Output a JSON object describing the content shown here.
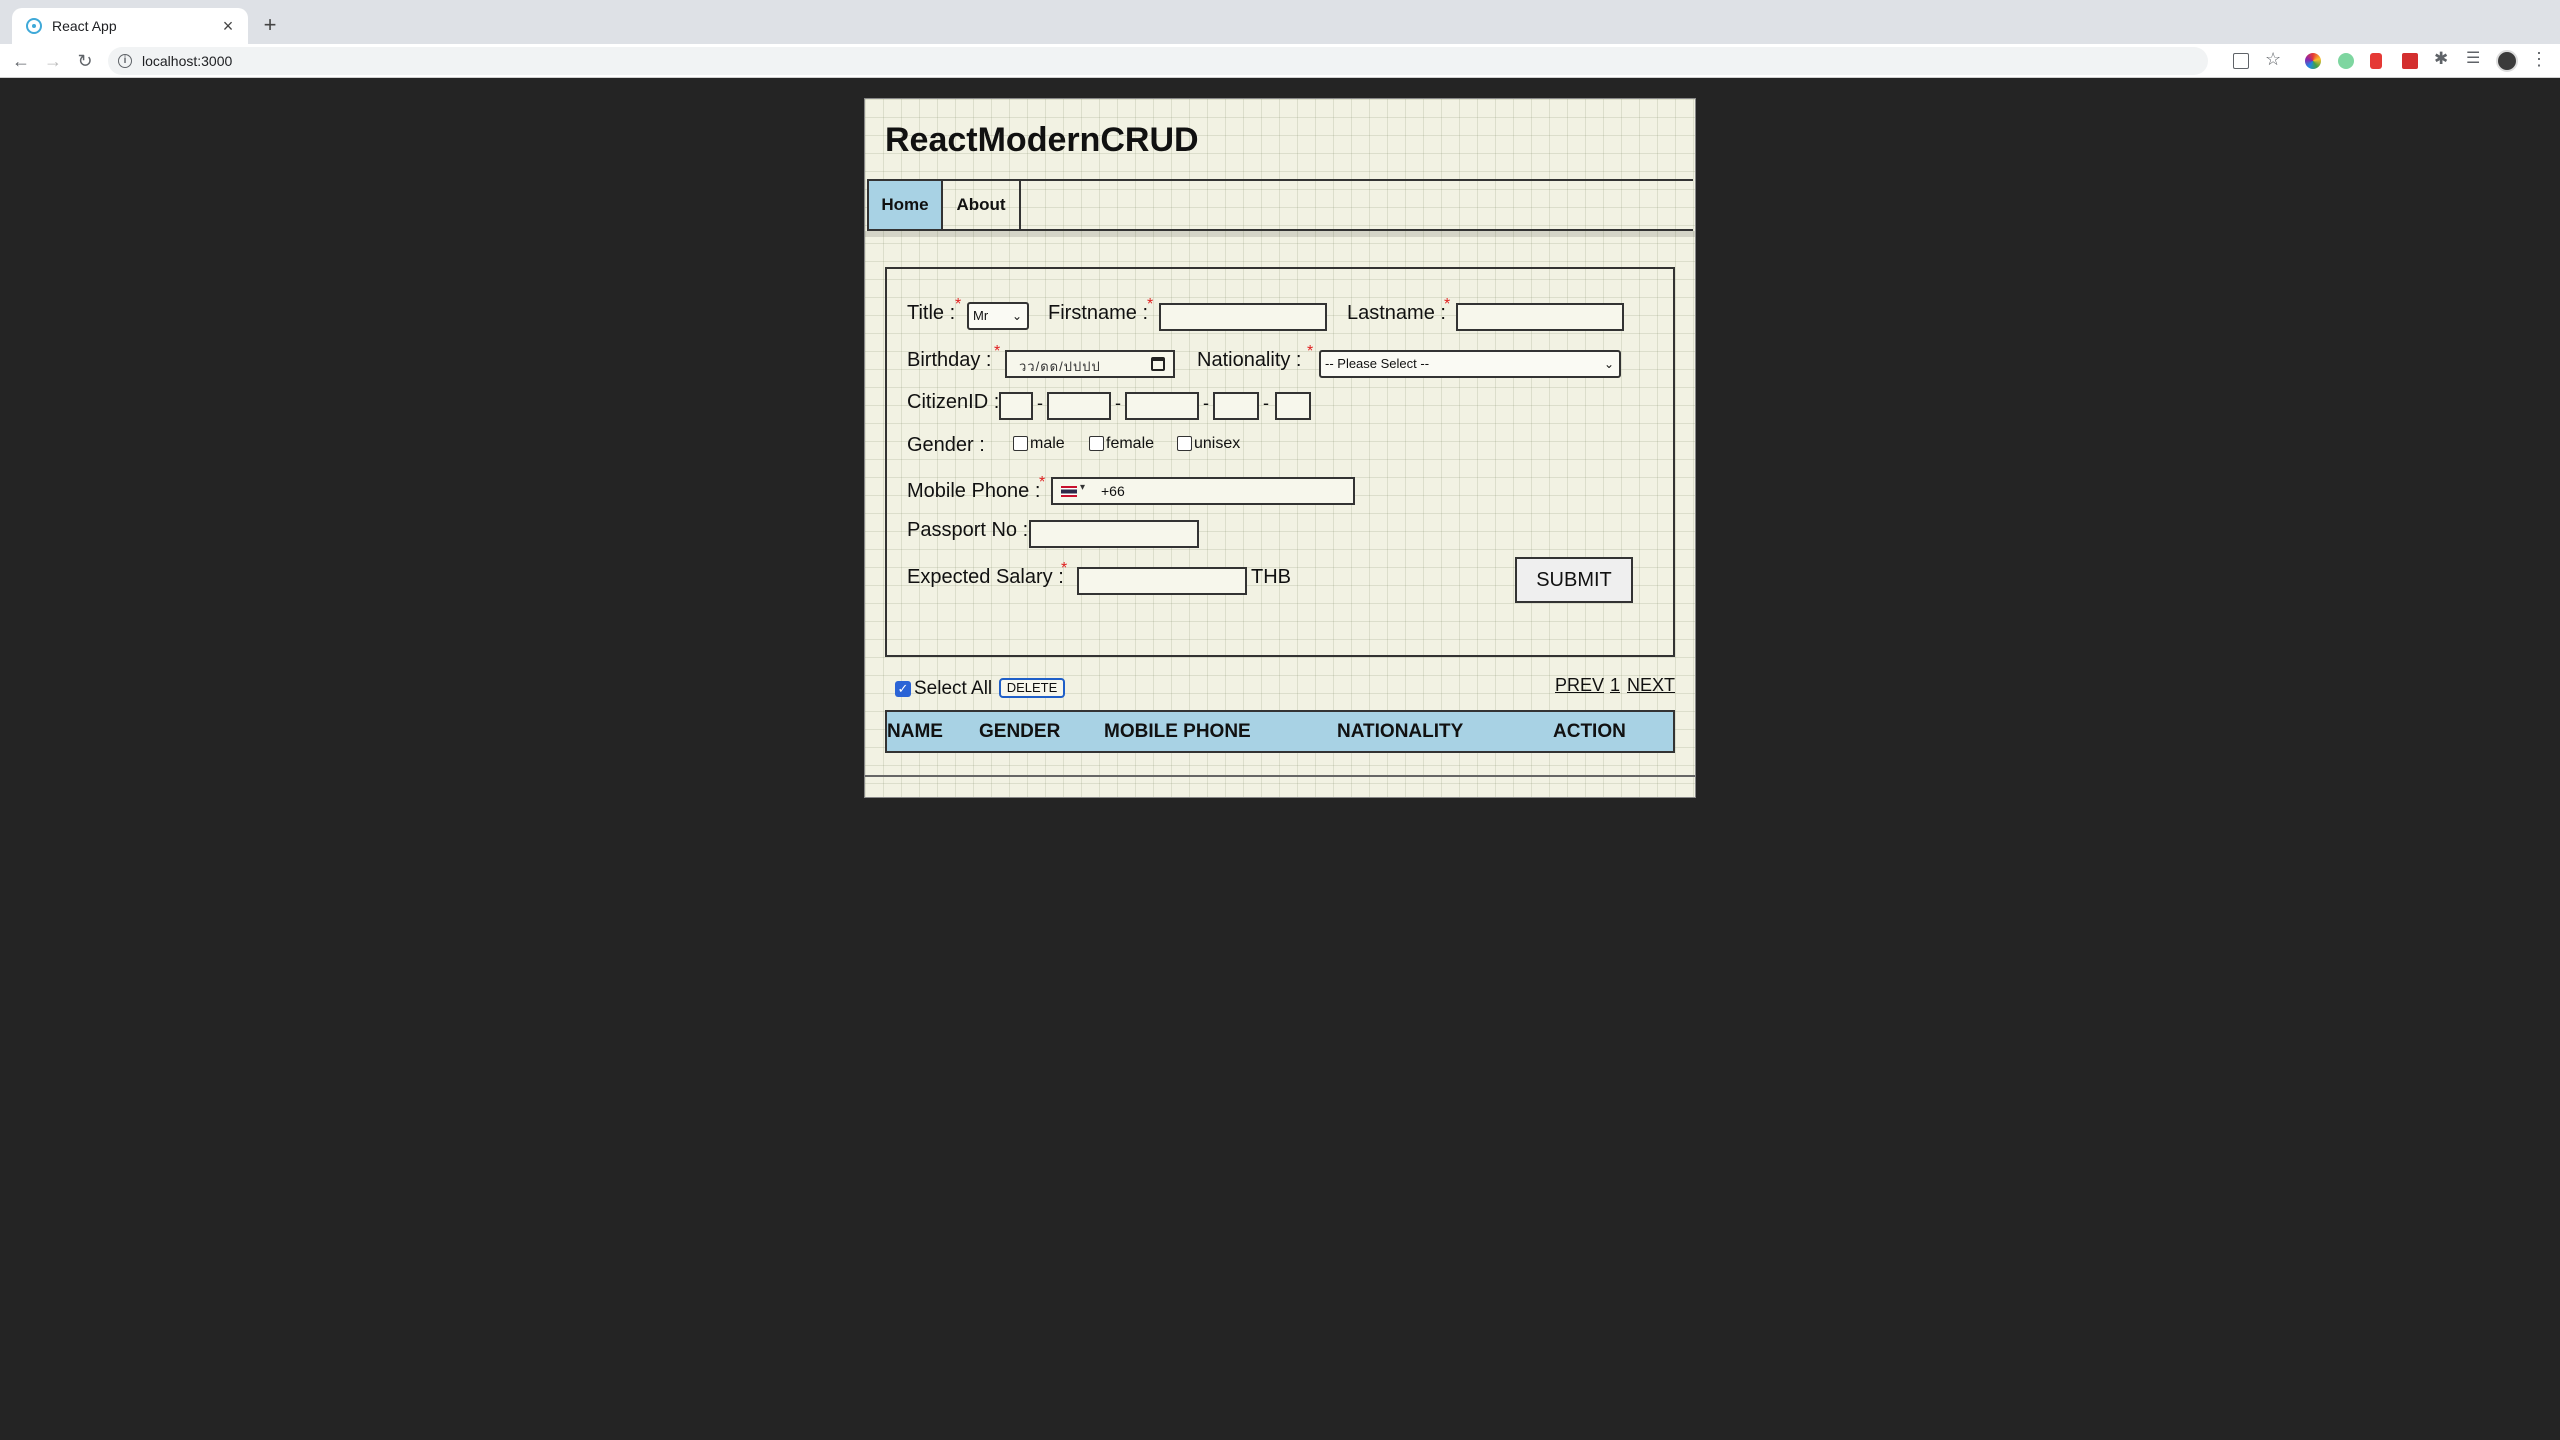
{
  "browser": {
    "tab_title": "React App",
    "tab_close": "×",
    "new_tab": "+",
    "back": "←",
    "forward": "→",
    "reload": "↻",
    "url": "localhost:3000"
  },
  "app": {
    "brand": "ReactModernCRUD",
    "nav": [
      {
        "label": "Home",
        "active": true
      },
      {
        "label": "About",
        "active": false
      }
    ]
  },
  "form": {
    "title_label": "Title :",
    "title_value": "Mr",
    "firstname_label": "Firstname :",
    "firstname_value": "",
    "lastname_label": "Lastname :",
    "lastname_value": "",
    "birthday_label": "Birthday :",
    "birthday_placeholder": "วว/ดด/ปปปป",
    "nationality_label": "Nationality :",
    "nationality_value": "-- Please Select --",
    "citizenid_label": "CitizenID :",
    "citizen_separator": "-",
    "gender_label": "Gender :",
    "gender_options": [
      "male",
      "female",
      "unisex"
    ],
    "mobile_label": "Mobile Phone :",
    "mobile_country_code": "+66",
    "passport_label": "Passport No :",
    "passport_value": "",
    "salary_label": "Expected Salary :",
    "salary_value": "",
    "salary_currency": "THB",
    "required_mark": "*",
    "submit_label": "SUBMIT"
  },
  "list": {
    "select_all_label": "Select All",
    "select_all_checked": true,
    "delete_label": "DELETE",
    "prev_label": "PREV",
    "page": "1",
    "next_label": "NEXT",
    "columns": [
      "NAME",
      "GENDER",
      "MOBILE PHONE",
      "NATIONALITY",
      "ACTION"
    ]
  },
  "colors": {
    "accent_blue": "#a8d2e4",
    "required_red": "#e02020",
    "checkbox_blue": "#2b64d6"
  }
}
